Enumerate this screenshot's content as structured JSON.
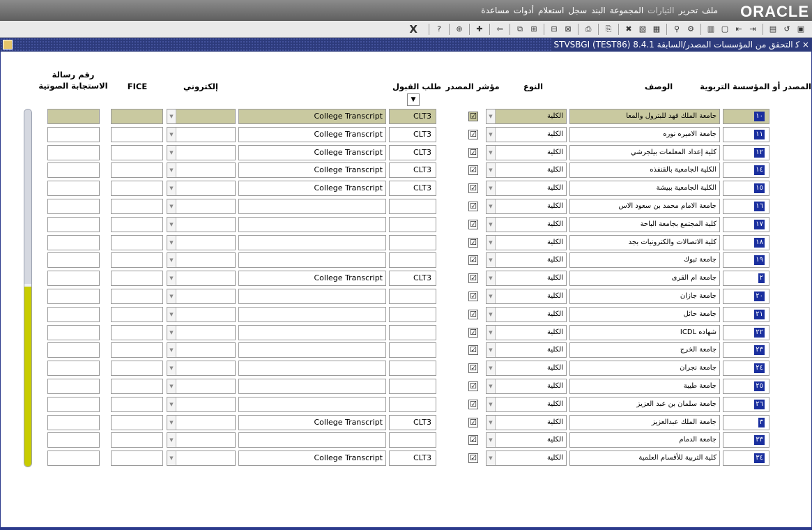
{
  "menubar": {
    "logo": "ORACLE",
    "items": [
      {
        "label": "ملف",
        "dim": false
      },
      {
        "label": "تحرير",
        "dim": false
      },
      {
        "label": "التيارات",
        "dim": true
      },
      {
        "label": "المجموعة",
        "dim": false
      },
      {
        "label": "البند",
        "dim": false
      },
      {
        "label": "سجل",
        "dim": false
      },
      {
        "label": "استعلام",
        "dim": false
      },
      {
        "label": "أدوات",
        "dim": false
      },
      {
        "label": "مساعدة",
        "dim": false
      }
    ]
  },
  "toolbar": {
    "exit_label": "X"
  },
  "window": {
    "title": "× ﮐ التحقق من المؤسسات المصدر/السابقة  8.4.1  (STVSBGI  (TEST86"
  },
  "headers": {
    "code": "المصدر أو المؤسسة التربوية",
    "desc": "الوصف",
    "type": "النوع",
    "indicator": "مؤشر المصدر",
    "accept": "طلب القبول",
    "electronic": "إلكتروني",
    "fice": "FICE",
    "voice_line1": "رقم رسالة",
    "voice_line2": "الاستجابة الصوتية"
  },
  "accept_dropdown": "▼",
  "rows": [
    {
      "code": "١٠",
      "desc": "جامعة الملك فهد للبترول والمعا",
      "type": "الكلية",
      "ind": "☑",
      "accept": "CLT3",
      "transcript": "College Transcript",
      "current": true
    },
    {
      "code": "١١",
      "desc": "جامعة الاميره نوره",
      "type": "الكلية",
      "ind": "☑",
      "accept": "CLT3",
      "transcript": "College Transcript",
      "current": false
    },
    {
      "code": "١٢",
      "desc": "كلية إعداد المعلمات بيلجرشي",
      "type": "الكلية",
      "ind": "☑",
      "accept": "CLT3",
      "transcript": "College Transcript",
      "current": false
    },
    {
      "code": "١٤",
      "desc": "الكلية الجامعية بالقنفذه",
      "type": "الكلية",
      "ind": "☑",
      "accept": "CLT3",
      "transcript": "College Transcript",
      "current": false
    },
    {
      "code": "١٥",
      "desc": "الكلية الجامعية ببيشة",
      "type": "الكلية",
      "ind": "☑",
      "accept": "CLT3",
      "transcript": "College Transcript",
      "current": false
    },
    {
      "code": "١٦",
      "desc": "جامعة الامام محمد بن سعود الاس",
      "type": "الكلية",
      "ind": "☑",
      "accept": "",
      "transcript": "",
      "current": false
    },
    {
      "code": "١٧",
      "desc": "كلية المجتمع بجامعة الباحة",
      "type": "الكلية",
      "ind": "☑",
      "accept": "",
      "transcript": "",
      "current": false
    },
    {
      "code": "١٨",
      "desc": "كلية الاتصالات والكترونيات بجد",
      "type": "الكلية",
      "ind": "☑",
      "accept": "",
      "transcript": "",
      "current": false
    },
    {
      "code": "١٩",
      "desc": "جامعة تبوك",
      "type": "الكلية",
      "ind": "☑",
      "accept": "",
      "transcript": "",
      "current": false
    },
    {
      "code": "٢",
      "desc": "جامعة ام القرى",
      "type": "الكلية",
      "ind": "☑",
      "accept": "CLT3",
      "transcript": "College Transcript",
      "current": false
    },
    {
      "code": "٢٠",
      "desc": "جامعة جازان",
      "type": "الكلية",
      "ind": "☑",
      "accept": "",
      "transcript": "",
      "current": false
    },
    {
      "code": "٢١",
      "desc": "جامعة حائل",
      "type": "الكلية",
      "ind": "☑",
      "accept": "",
      "transcript": "",
      "current": false
    },
    {
      "code": "٢٢",
      "desc": "شهاده ICDL",
      "type": "الكلية",
      "ind": "☑",
      "accept": "",
      "transcript": "",
      "current": false
    },
    {
      "code": "٢٣",
      "desc": "جامعة الخرج",
      "type": "الكلية",
      "ind": "☑",
      "accept": "",
      "transcript": "",
      "current": false
    },
    {
      "code": "٢٤",
      "desc": "جامعة نجران",
      "type": "الكلية",
      "ind": "☑",
      "accept": "",
      "transcript": "",
      "current": false
    },
    {
      "code": "٢٥",
      "desc": "جامعة طيبة",
      "type": "الكلية",
      "ind": "☑",
      "accept": "",
      "transcript": "",
      "current": false
    },
    {
      "code": "٢٦",
      "desc": "جامعة سلمان بن عبد العزيز",
      "type": "الكلية",
      "ind": "☑",
      "accept": "",
      "transcript": "",
      "current": false
    },
    {
      "code": "٣",
      "desc": "جامعة الملك عبدالعزيز",
      "type": "الكلية",
      "ind": "☑",
      "accept": "CLT3",
      "transcript": "College Transcript",
      "current": false
    },
    {
      "code": "٣٣",
      "desc": "جامعة الدمام",
      "type": "الكلية",
      "ind": "☑",
      "accept": "",
      "transcript": "",
      "current": false
    },
    {
      "code": "٣٤",
      "desc": "كلية التربية للأقسام العلمية",
      "type": "الكلية",
      "ind": "☑",
      "accept": "CLT3",
      "transcript": "College Transcript",
      "current": false
    }
  ]
}
